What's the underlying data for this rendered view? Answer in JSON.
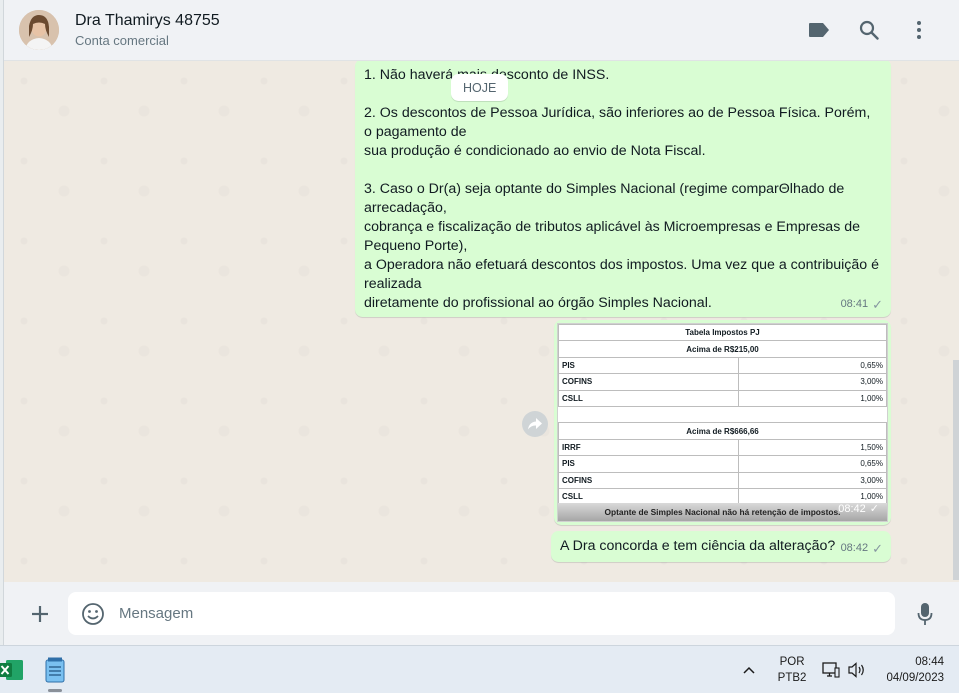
{
  "header": {
    "contact_name": "Dra Thamirys 48755",
    "contact_sub": "Conta comercial",
    "icons": [
      "label-icon",
      "search-icon",
      "menu-icon"
    ]
  },
  "date_chip": "HOJE",
  "messages": {
    "policy": {
      "text": "1. Não haverá mais desconto de INSS.\n\n2. Os descontos de Pessoa Jurídica, são inferiores ao de Pessoa Física. Porém, o pagamento de\nsua produção é condicionado ao envio de Nota Fiscal.\n\n3. Caso o Dr(a) seja optante do Simples Nacional (regime comparΘlhado de arrecadação,\ncobrança e fiscalização de tributos aplicável às Microempresas e Empresas de Pequeno Porte),\na Operadora não efetuará descontos dos impostos. Uma vez que a contribuição é realizada\ndiretamente do profissional ao órgão Simples Nacional.",
      "time": "08:41"
    },
    "image": {
      "title": "Tabela Impostos PJ",
      "section1_header": "Acima de R$215,00",
      "section1_rows": [
        {
          "label": "PIS",
          "value": "0,65%"
        },
        {
          "label": "COFINS",
          "value": "3,00%"
        },
        {
          "label": "CSLL",
          "value": "1,00%"
        }
      ],
      "section2_header": "Acima de R$666,66",
      "section2_rows": [
        {
          "label": "IRRF",
          "value": "1,50%"
        },
        {
          "label": "PIS",
          "value": "0,65%"
        },
        {
          "label": "COFINS",
          "value": "3,00%"
        },
        {
          "label": "CSLL",
          "value": "1,00%"
        }
      ],
      "footer": "Optante de Simples Nacional não há retenção de impostos.",
      "time": "08:42"
    },
    "question": {
      "text": "A Dra concorda e tem ciência da alteração?",
      "time": "08:42"
    }
  },
  "compose": {
    "placeholder": "Mensagem"
  },
  "taskbar": {
    "apps": [
      "excel-icon",
      "notepad-icon"
    ],
    "lang_top": "POR",
    "lang_bottom": "PTB2",
    "time": "08:44",
    "date": "04/09/2023"
  },
  "colors": {
    "outgoing_bubble": "#d9fdd3",
    "header_bg": "#f0f2f5",
    "chat_bg": "#efeae2",
    "icon_gray": "#54656f"
  }
}
